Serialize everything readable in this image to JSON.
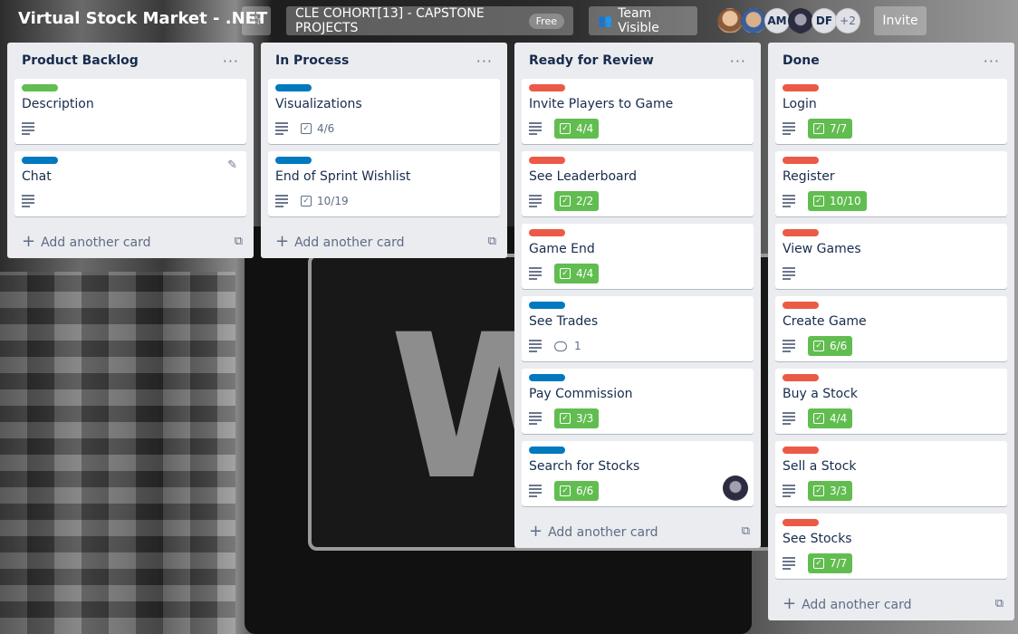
{
  "colors": {
    "green": "#61bd4f",
    "blue": "#0079bf",
    "red": "#eb5a46",
    "lime": "#61bd4f"
  },
  "header": {
    "board_title": "Virtual Stock Market - .NET",
    "team": "CLE COHORT[13] - CAPSTONE PROJECTS",
    "team_badge": "Free",
    "visibility": "Team Visible",
    "invite": "Invite",
    "members": [
      "AM",
      "DF"
    ],
    "more_members": "+2"
  },
  "common": {
    "add_card": "Add another card",
    "menu": "···"
  },
  "lists": [
    {
      "title": "Product Backlog",
      "cards": [
        {
          "label": "green",
          "title": "Description"
        },
        {
          "label": "blue",
          "title": "Chat"
        }
      ]
    },
    {
      "title": "In Process",
      "cards": [
        {
          "label": "blue",
          "title": "Visualizations",
          "checklist": "4/6"
        },
        {
          "label": "blue",
          "title": "End of Sprint Wishlist",
          "checklist": "10/19"
        }
      ]
    },
    {
      "title": "Ready for Review",
      "cards": [
        {
          "label": "red",
          "title": "Invite Players to Game",
          "checklist": "4/4"
        },
        {
          "label": "red",
          "title": "See Leaderboard",
          "checklist": "2/2"
        },
        {
          "label": "red",
          "title": "Game End",
          "checklist": "4/4"
        },
        {
          "label": "blue",
          "title": "See Trades",
          "comments": "1"
        },
        {
          "label": "blue",
          "title": "Pay Commission",
          "checklist": "3/3"
        },
        {
          "label": "blue",
          "title": "Search for Stocks",
          "checklist": "6/6"
        }
      ]
    },
    {
      "title": "Done",
      "cards": [
        {
          "label": "red",
          "title": "Login",
          "checklist": "7/7"
        },
        {
          "label": "red",
          "title": "Register",
          "checklist": "10/10"
        },
        {
          "label": "red",
          "title": "View Games"
        },
        {
          "label": "red",
          "title": "Create Game",
          "checklist": "6/6"
        },
        {
          "label": "red",
          "title": "Buy a Stock",
          "checklist": "4/4"
        },
        {
          "label": "red",
          "title": "Sell a Stock",
          "checklist": "3/3"
        },
        {
          "label": "red",
          "title": "See Stocks",
          "checklist": "7/7"
        }
      ]
    }
  ]
}
